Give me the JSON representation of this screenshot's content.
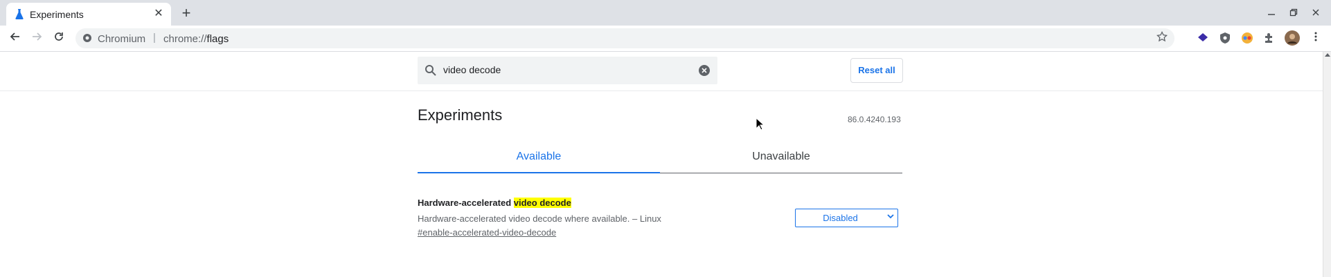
{
  "browser": {
    "tab_title": "Experiments",
    "tab_close": "✕",
    "new_tab": "+",
    "omnibox_origin": "Chromium",
    "omnibox_separator": "|",
    "omnibox_scheme": "chrome://",
    "omnibox_path": "flags",
    "extension_icons": [
      "layers-ext-icon",
      "shield-ext-icon",
      "glasses-ext-icon",
      "puzzle-extensions-icon"
    ],
    "window_controls": [
      "minimize-icon",
      "restore-icon",
      "close-icon"
    ]
  },
  "search": {
    "value": "video decode",
    "reset_label": "Reset all"
  },
  "page": {
    "heading": "Experiments",
    "version": "86.0.4240.193",
    "tabs": [
      {
        "label": "Available",
        "active": true
      },
      {
        "label": "Unavailable",
        "active": false
      }
    ]
  },
  "flags": [
    {
      "title_prefix": "Hardware-accelerated ",
      "title_highlight": "video decode",
      "description": "Hardware-accelerated video decode where available. – Linux",
      "link": "#enable-accelerated-video-decode",
      "selected_option": "Disabled"
    }
  ],
  "colors": {
    "accent": "#1a73e8",
    "highlight": "#ffff00",
    "tabstrip": "#dee1e6"
  }
}
